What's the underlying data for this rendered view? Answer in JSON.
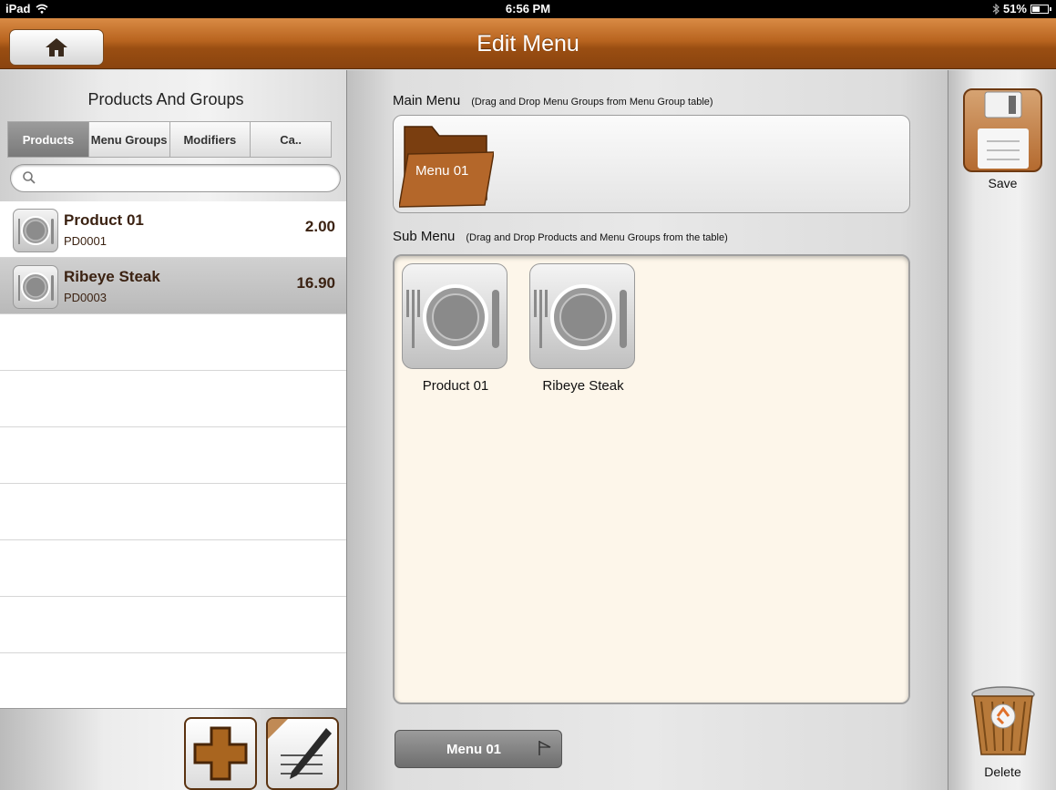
{
  "status_bar": {
    "device": "iPad",
    "time": "6:56 PM",
    "battery": "51%",
    "battery_level": 0.51
  },
  "nav": {
    "title": "Edit Menu"
  },
  "left_panel": {
    "heading": "Products And Groups",
    "tabs": [
      {
        "label": "Products",
        "active": true
      },
      {
        "label": "Menu Groups",
        "active": false
      },
      {
        "label": "Modifiers",
        "active": false
      },
      {
        "label": "Ca..",
        "active": false
      }
    ],
    "search": {
      "placeholder": "",
      "value": ""
    },
    "products": [
      {
        "name": "Product 01",
        "code": "PD0001",
        "price": "2.00",
        "selected": false
      },
      {
        "name": "Ribeye Steak",
        "code": "PD0003",
        "price": "16.90",
        "selected": true
      }
    ]
  },
  "main_menu": {
    "label": "Main Menu",
    "hint": "(Drag and Drop Menu Groups from Menu Group table)",
    "groups": [
      {
        "name": "Menu 01"
      }
    ]
  },
  "sub_menu": {
    "label": "Sub Menu",
    "hint": "(Drag and Drop Products and Menu Groups from the table)",
    "items": [
      {
        "name": "Product 01"
      },
      {
        "name": "Ribeye Steak"
      }
    ]
  },
  "bottom_tab": {
    "label": "Menu 01"
  },
  "right_panel": {
    "save_label": "Save",
    "delete_label": "Delete"
  },
  "colors": {
    "nav_brown": "#b8641f",
    "text_brown": "#3b2212",
    "submenu_bg": "#fdf6ea"
  }
}
